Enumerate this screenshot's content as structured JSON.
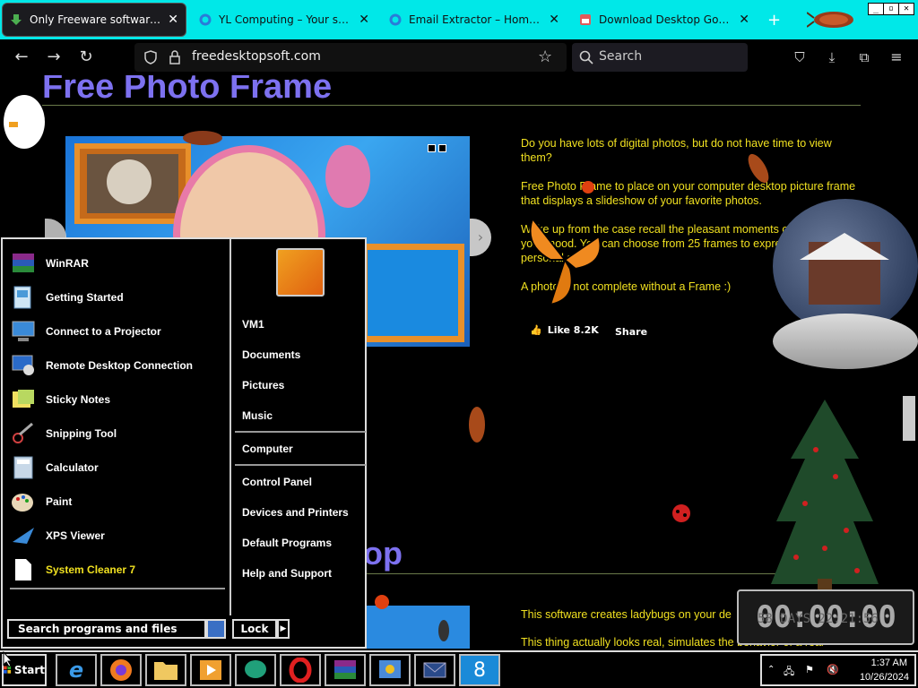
{
  "browser": {
    "tabs": [
      {
        "title": "Only Freeware software for your",
        "active": true
      },
      {
        "title": "YL Computing – Your satisfactio",
        "active": false
      },
      {
        "title": "Email Extractor – Home – YL Co",
        "active": false
      },
      {
        "title": "Download Desktop Goose by sa",
        "active": false
      }
    ],
    "tab_close": "✕",
    "new_tab": "+",
    "url": "freedesktopsoft.com",
    "search_placeholder": "Search"
  },
  "page": {
    "heading": "Free Photo Frame",
    "paragraphs": [
      "Do you have lots of digital photos, but do not have time to view them?",
      "Free Photo Frame to place on your computer desktop picture frame that displays a slideshow of your favorite photos.",
      "Wake up from the case recall the pleasant moments of your life, lift your mood. You can choose from 25 frames to express your personal style.",
      "A photo is not complete without a Frame :)"
    ],
    "like_label": "Like 8.2K",
    "share_label": "Share",
    "heading2": "op",
    "paragraphs2": [
      "This software creates ladybugs on your de",
      "This thing actually looks real, simulates the behavior of a real"
    ]
  },
  "start_menu": {
    "programs": [
      {
        "label": "WinRAR",
        "icon": "winrar-icon"
      },
      {
        "label": "Getting Started",
        "icon": "getting-started-icon"
      },
      {
        "label": "Connect to a Projector",
        "icon": "projector-icon"
      },
      {
        "label": "Remote Desktop Connection",
        "icon": "remote-desktop-icon"
      },
      {
        "label": "Sticky Notes",
        "icon": "sticky-notes-icon"
      },
      {
        "label": "Snipping Tool",
        "icon": "snipping-tool-icon"
      },
      {
        "label": "Calculator",
        "icon": "calculator-icon"
      },
      {
        "label": "Paint",
        "icon": "paint-icon"
      },
      {
        "label": "XPS Viewer",
        "icon": "xps-viewer-icon"
      },
      {
        "label": "System Cleaner 7",
        "icon": "document-icon",
        "highlight": true
      }
    ],
    "places": [
      "VM1",
      "Documents",
      "Pictures",
      "Music",
      "Computer",
      "Control Panel",
      "Devices and Printers",
      "Default Programs",
      "Help and Support"
    ],
    "search_placeholder": "Search programs and files",
    "lock_label": "Lock"
  },
  "taskbar": {
    "start_label": "Start",
    "apps": [
      "internet-explorer",
      "firefox",
      "file-explorer",
      "media-player",
      "chat-app",
      "opera",
      "winrar",
      "control-panel-app",
      "email-app",
      "app-8"
    ],
    "time": "1:37 AM",
    "date": "10/26/2024"
  },
  "countdown": {
    "display": "00:00:00",
    "subtext": "58 DAYS 22:21:56"
  }
}
